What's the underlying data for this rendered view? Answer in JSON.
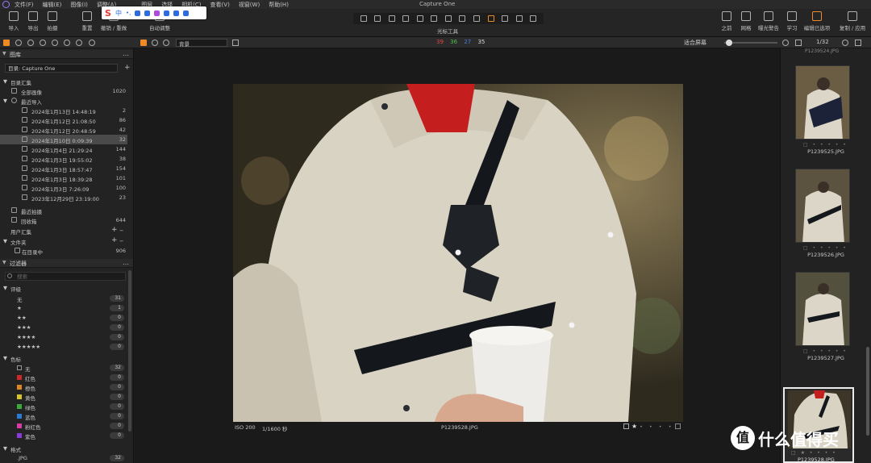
{
  "window": {
    "title": "Capture One"
  },
  "menu": [
    "文件(F)",
    "编辑(E)",
    "图像(I)",
    "调整(A)",
    "图层",
    "选择",
    "相机(C)",
    "查看(V)",
    "视窗(W)",
    "帮助(H)"
  ],
  "ime": {
    "logo": "S",
    "mode": "中",
    "punct": "•,"
  },
  "toolbar": {
    "import": "导入",
    "export": "导出",
    "capture": "拍摄",
    "reset": "重置",
    "undo": "撤销 / 重做",
    "auto": "自动调整",
    "cursor_tools": "光标工具",
    "before": "之前",
    "grid": "网格",
    "exposure_warn": "曝光警告",
    "learn": "学习",
    "edit_selected": "编辑已选项",
    "copy_apply": "复制 / 应用"
  },
  "subbar": {
    "background": "背景",
    "count_red": "39",
    "count_green": "36",
    "count_blue": "27",
    "count_white": "35",
    "fit": "适合屏幕",
    "page": "1/32",
    "colors": {
      "red": "#e04646",
      "green": "#4cc24c",
      "blue": "#4c7ce0",
      "white": "#d8d8d8"
    }
  },
  "library": {
    "title": "图库",
    "catalog": "目录: Capture One",
    "catalog_collections": "目录汇集",
    "all_images": {
      "label": "全部画像",
      "count": "1020"
    },
    "recent_imports": "最近导入",
    "imports": [
      {
        "label": "2024年1月13日 14:48:19",
        "count": "2"
      },
      {
        "label": "2024年1月12日 21:08:50",
        "count": "86"
      },
      {
        "label": "2024年1月12日 20:48:59",
        "count": "42"
      },
      {
        "label": "2024年1月10日 0:09:39",
        "count": "32"
      },
      {
        "label": "2024年1月4日 21:29:24",
        "count": "144"
      },
      {
        "label": "2024年1月3日 19:55:02",
        "count": "38"
      },
      {
        "label": "2024年1月3日 18:57:47",
        "count": "154"
      },
      {
        "label": "2024年1月3日 18:39:28",
        "count": "101"
      },
      {
        "label": "2024年1月3日 7:26:09",
        "count": "100"
      },
      {
        "label": "2023年12月29日 23:19:00",
        "count": "23"
      }
    ],
    "recent_captures": "最近拍摄",
    "trash": {
      "label": "回收箱",
      "count": "644"
    },
    "user_collections": "用户汇集",
    "folders": "文件夹",
    "in_catalog": {
      "label": "在目录中",
      "count": "906"
    }
  },
  "filters": {
    "title": "过滤器",
    "search_placeholder": "搜索",
    "rating_title": "评级",
    "ratings": [
      {
        "label": "无",
        "count": "31"
      },
      {
        "label": "★",
        "count": "1"
      },
      {
        "label": "★★",
        "count": "0"
      },
      {
        "label": "★★★",
        "count": "0"
      },
      {
        "label": "★★★★",
        "count": "0"
      },
      {
        "label": "★★★★★",
        "count": "0"
      }
    ],
    "color_title": "色标",
    "color_tags": [
      {
        "label": "无",
        "count": "32",
        "color": "#1d1d1d"
      },
      {
        "label": "红色",
        "count": "0",
        "color": "#d0282a"
      },
      {
        "label": "橙色",
        "count": "0",
        "color": "#e0862a"
      },
      {
        "label": "黄色",
        "count": "0",
        "color": "#d8c42a"
      },
      {
        "label": "绿色",
        "count": "0",
        "color": "#3aaa3a"
      },
      {
        "label": "蓝色",
        "count": "0",
        "color": "#2a7ad8"
      },
      {
        "label": "粉红色",
        "count": "0",
        "color": "#d83aa8"
      },
      {
        "label": "紫色",
        "count": "0",
        "color": "#8a3ad8"
      }
    ],
    "format_title": "格式",
    "format": {
      "label": ".JPG",
      "count": "32"
    }
  },
  "viewer": {
    "iso": "ISO 200",
    "shutter": "1/1600 秒",
    "filename": "P1239528.JPG"
  },
  "browser": {
    "thumbs": [
      {
        "name": "P1239525.JPG"
      },
      {
        "name": "P1239526.JPG"
      },
      {
        "name": "P1239527.JPG"
      },
      {
        "name": "P1239528.JPG"
      }
    ]
  },
  "watermark": {
    "glyph": "值",
    "text": "什么值得买"
  }
}
